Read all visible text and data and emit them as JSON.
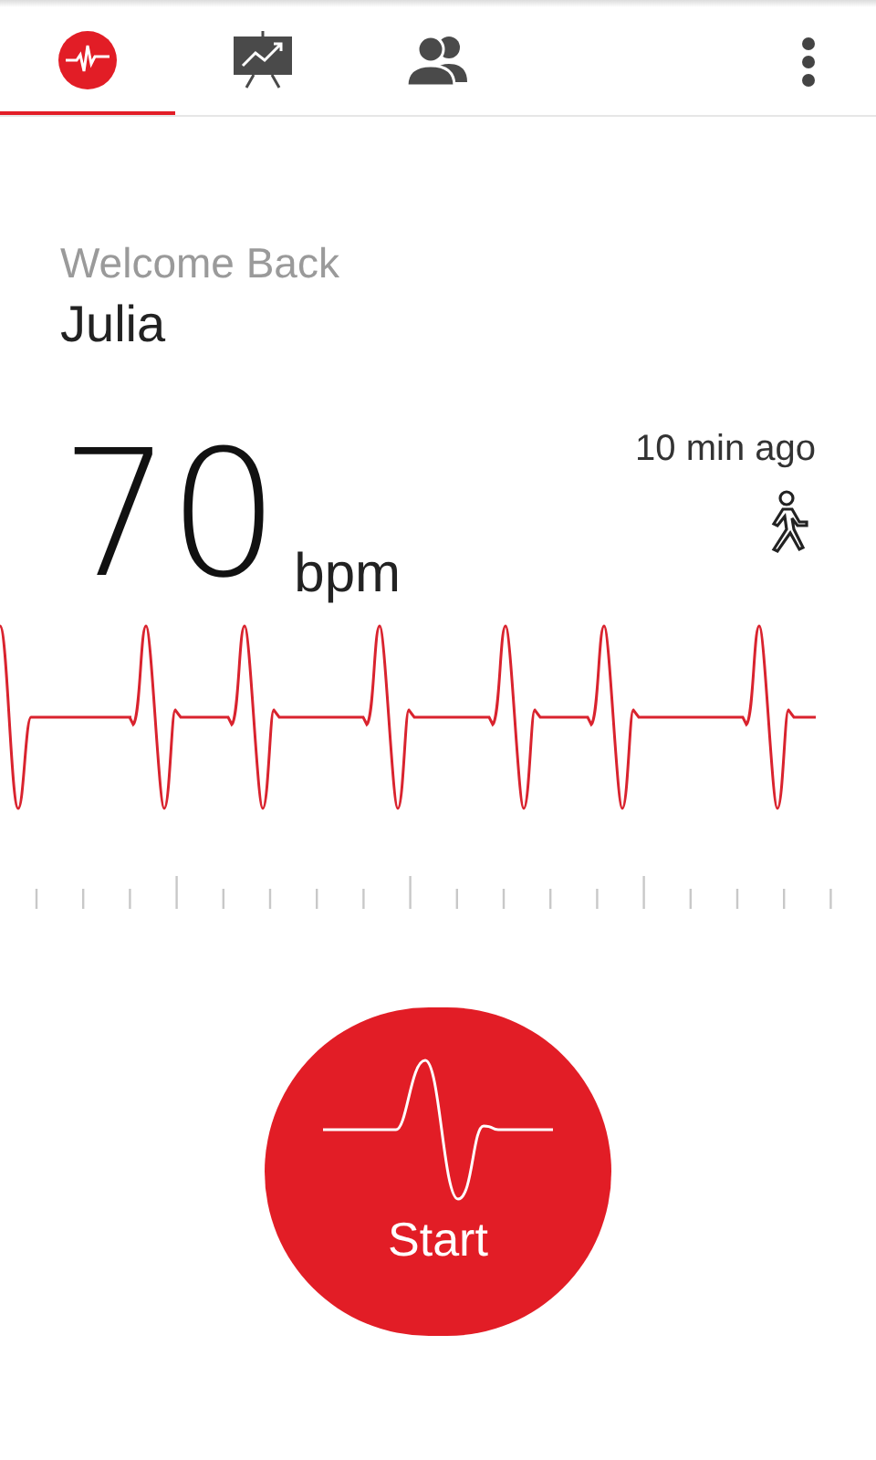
{
  "tabs": [
    {
      "kind": "heart",
      "selected": true
    },
    {
      "kind": "chart",
      "selected": false
    },
    {
      "kind": "people",
      "selected": false
    }
  ],
  "greeting": "Welcome Back",
  "user_name": "Julia",
  "reading": {
    "value": "70",
    "unit": "bpm",
    "time": "10 min ago"
  },
  "start_button": {
    "label": "Start"
  }
}
